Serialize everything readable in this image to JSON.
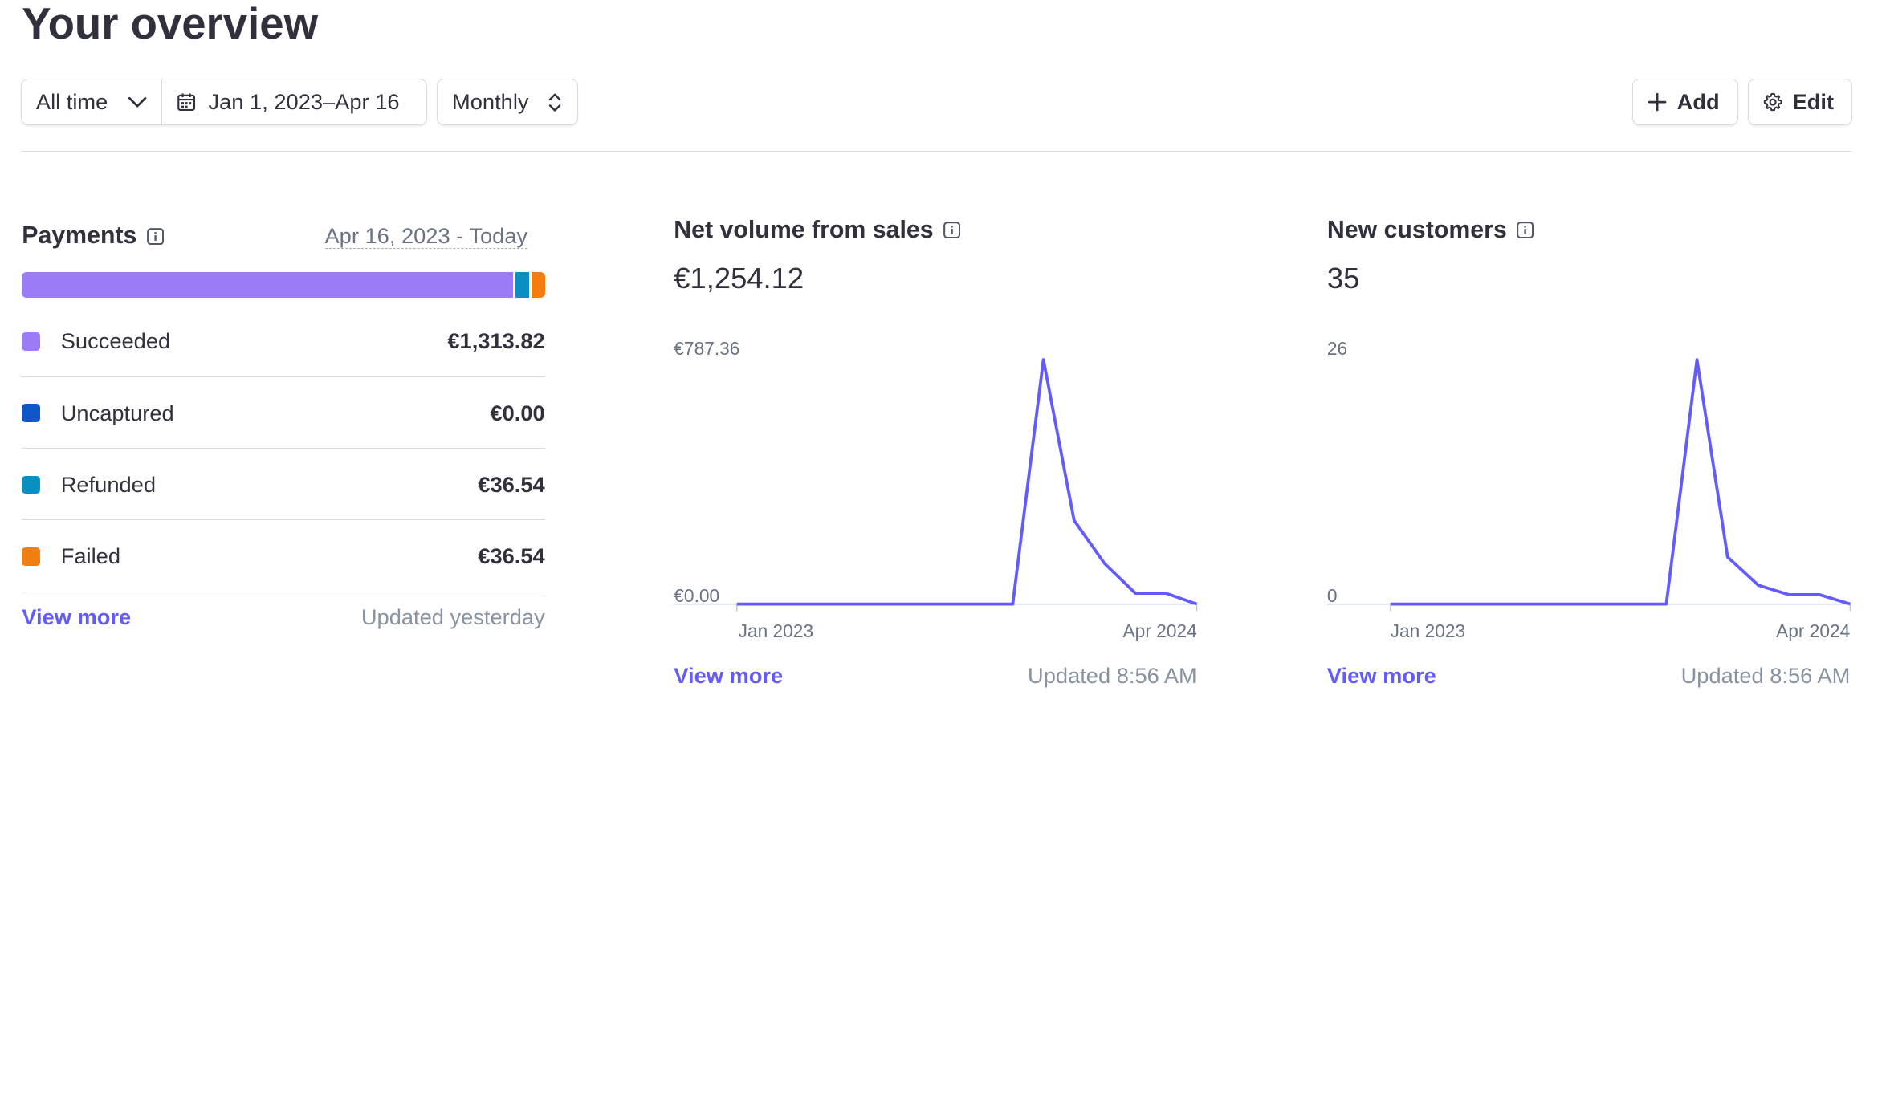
{
  "header": {
    "title": "Your overview"
  },
  "filters": {
    "period": "All time",
    "date_range": "Jan 1, 2023–Apr 16",
    "interval": "Monthly"
  },
  "actions": {
    "add_label": "Add",
    "edit_label": "Edit"
  },
  "payments": {
    "title": "Payments",
    "range": "Apr 16, 2023 - Today",
    "legend": [
      {
        "label": "Succeeded",
        "value": "€1,313.82",
        "color": "#9c7bf6"
      },
      {
        "label": "Uncaptured",
        "value": "€0.00",
        "color": "#0d57c9"
      },
      {
        "label": "Refunded",
        "value": "€36.54",
        "color": "#0b8ec0"
      },
      {
        "label": "Failed",
        "value": "€36.54",
        "color": "#f27e12"
      }
    ],
    "bar_shares": [
      0.9475,
      0.0,
      0.02635,
      0.02635
    ],
    "view_more": "View more",
    "updated": "Updated yesterday"
  },
  "net_volume": {
    "title": "Net volume from sales",
    "total": "€1,254.12",
    "y_max_label": "€787.36",
    "y_min_label": "€0.00",
    "x_start_label": "Jan 2023",
    "x_end_label": "Apr 2024",
    "view_more": "View more",
    "updated": "Updated 8:56 AM"
  },
  "new_customers": {
    "title": "New customers",
    "total": "35",
    "y_max_label": "26",
    "y_min_label": "0",
    "x_start_label": "Jan 2023",
    "x_end_label": "Apr 2024",
    "view_more": "View more",
    "updated": "Updated 8:56 AM"
  },
  "chart_data": [
    {
      "type": "line",
      "title": "Net volume from sales",
      "x": [
        "Jan 2023",
        "Feb 2023",
        "Mar 2023",
        "Apr 2023",
        "May 2023",
        "Jun 2023",
        "Jul 2023",
        "Aug 2023",
        "Sep 2023",
        "Oct 2023",
        "Nov 2023",
        "Dec 2023",
        "Jan 2024",
        "Feb 2024",
        "Mar 2024",
        "Apr 2024"
      ],
      "series": [
        {
          "values": [
            0,
            0,
            0,
            0,
            0,
            0,
            0,
            0,
            0,
            0,
            787.36,
            270,
            130,
            35,
            35,
            0
          ]
        }
      ],
      "ylim": [
        0,
        787.36
      ],
      "color": "#635bff"
    },
    {
      "type": "line",
      "title": "New customers",
      "x": [
        "Jan 2023",
        "Feb 2023",
        "Mar 2023",
        "Apr 2023",
        "May 2023",
        "Jun 2023",
        "Jul 2023",
        "Aug 2023",
        "Sep 2023",
        "Oct 2023",
        "Nov 2023",
        "Dec 2023",
        "Jan 2024",
        "Feb 2024",
        "Mar 2024",
        "Apr 2024"
      ],
      "series": [
        {
          "values": [
            0,
            0,
            0,
            0,
            0,
            0,
            0,
            0,
            0,
            0,
            26,
            5,
            2,
            1,
            1,
            0
          ]
        }
      ],
      "ylim": [
        0,
        26
      ],
      "color": "#635bff"
    }
  ]
}
